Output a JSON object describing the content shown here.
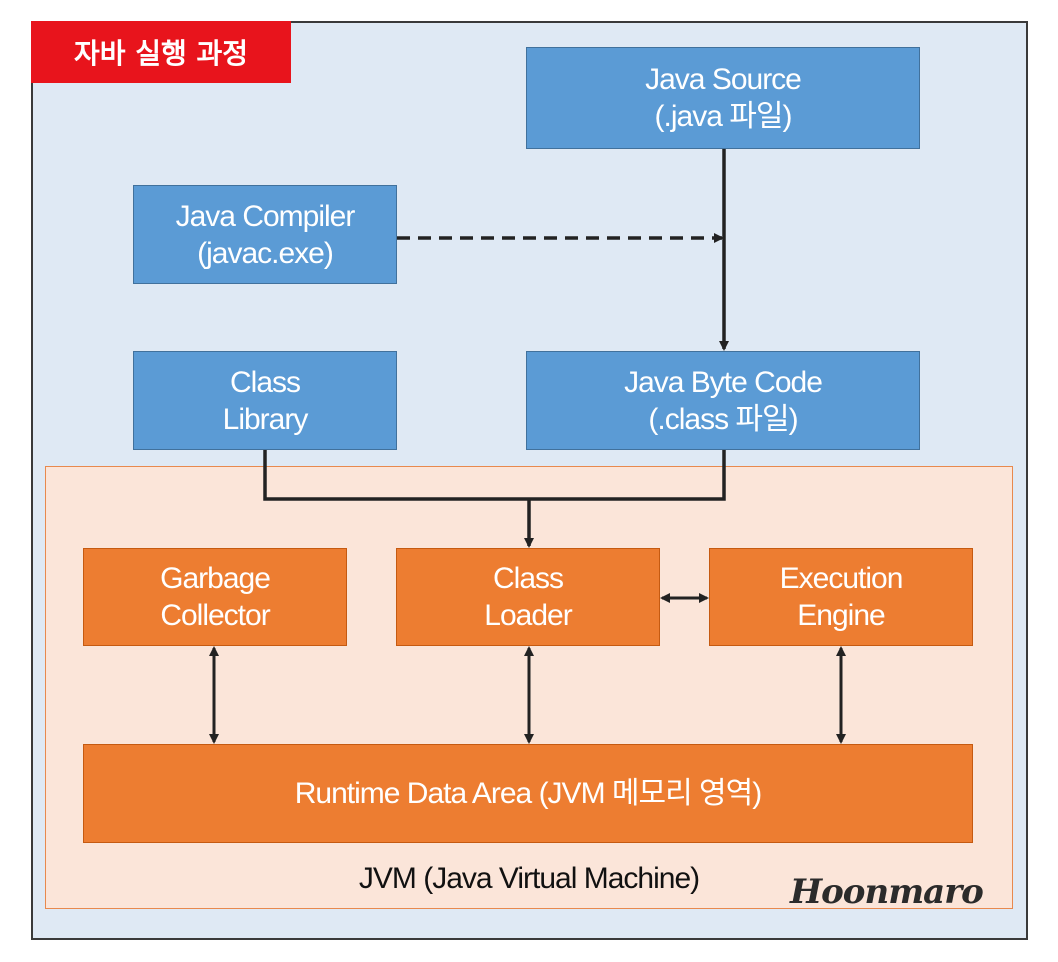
{
  "title_tag": "자바 실행 과정",
  "boxes": {
    "java_source": [
      "Java Source",
      "(.java 파일)"
    ],
    "java_compiler": [
      "Java Compiler",
      "(javac.exe)"
    ],
    "class_library": [
      "Class",
      "Library"
    ],
    "byte_code": [
      "Java Byte Code",
      "(.class 파일)"
    ],
    "garbage_collector": [
      "Garbage",
      "Collector"
    ],
    "class_loader": [
      "Class",
      "Loader"
    ],
    "execution_engine": [
      "Execution",
      "Engine"
    ],
    "runtime_data_area": "Runtime Data Area (JVM 메모리 영역)"
  },
  "jvm_label": "JVM (Java Virtual Machine)",
  "signature": "Hoonmaro",
  "colors": {
    "frame_bg": "#dfe9f4",
    "title_red": "#e8141c",
    "blue_box": "#5b9bd5",
    "orange_box": "#ed7d31",
    "jvm_bg": "#fbe5d9"
  }
}
